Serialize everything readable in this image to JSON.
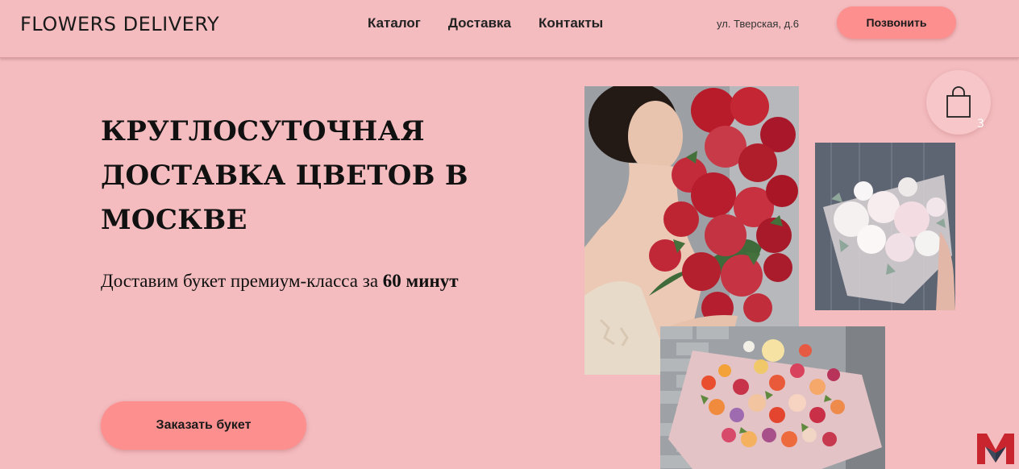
{
  "header": {
    "logo": "FLOWERS DELIVERY",
    "nav": [
      "Каталог",
      "Доставка",
      "Контакты"
    ],
    "address": "ул. Тверская, д.6",
    "call_button": "Позвонить"
  },
  "cart": {
    "icon": "shopping-bag-icon",
    "count": "3"
  },
  "hero": {
    "title_lines": [
      "КРУГЛОСУТОЧНАЯ",
      "ДОСТАВКА ЦВЕТОВ В",
      "МОСКВЕ"
    ],
    "subtitle_text": "Доставим букет премиум-класса за ",
    "subtitle_bold": "60 минут",
    "order_button": "Заказать букет"
  },
  "images": [
    {
      "name": "woman-with-red-roses-photo"
    },
    {
      "name": "white-peony-bouquet-photo"
    },
    {
      "name": "mixed-flower-bouquet-photo"
    }
  ],
  "colors": {
    "background": "#f4bcbf",
    "button": "#fd8f8f",
    "text": "#111111"
  }
}
